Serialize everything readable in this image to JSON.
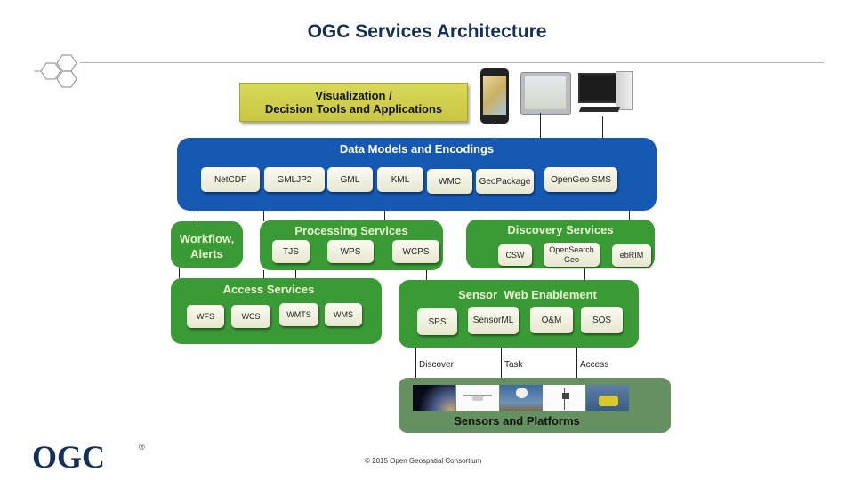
{
  "title": "OGC Services Architecture",
  "visualization": {
    "line1": "Visualization /",
    "line2": "Decision Tools and Applications",
    "devices": [
      "smartphone",
      "tablet",
      "desktop-computer"
    ]
  },
  "data_models": {
    "title": "Data Models and Encodings",
    "items": [
      "NetCDF",
      "GMLJP2",
      "GML",
      "KML",
      "WMC",
      "GeoPackage",
      "OpenGeo SMS"
    ]
  },
  "workflow": {
    "line1": "Workflow,",
    "line2": "Alerts"
  },
  "processing": {
    "title": "Processing Services",
    "items": [
      "TJS",
      "WPS",
      "WCPS"
    ]
  },
  "discovery": {
    "title": "Discovery Services",
    "items": [
      "CSW",
      "OpenSearch Geo",
      "ebRIM"
    ]
  },
  "access": {
    "title": "Access Services",
    "items": [
      "WFS",
      "WCS",
      "WMTS",
      "WMS"
    ]
  },
  "swe": {
    "title": "Sensor  Web Enablement",
    "items": [
      "SPS",
      "SensorML",
      "O&M",
      "SOS"
    ],
    "links": [
      "Discover",
      "Task",
      "Access"
    ]
  },
  "sensors": {
    "title": "Sensors and Platforms",
    "images": [
      "satellite",
      "drone",
      "weather-radar",
      "weather-station",
      "buoy"
    ]
  },
  "footer": {
    "logo": "OGC",
    "registered": "®",
    "copyright": "© 2015 Open Geospatial Consortium"
  },
  "colors": {
    "title": "#14305a",
    "blue_panel": "#1559b3",
    "green_panel": "#3a9a35",
    "sensors_panel": "#65905f",
    "viz_box": "#d1cf4c"
  }
}
